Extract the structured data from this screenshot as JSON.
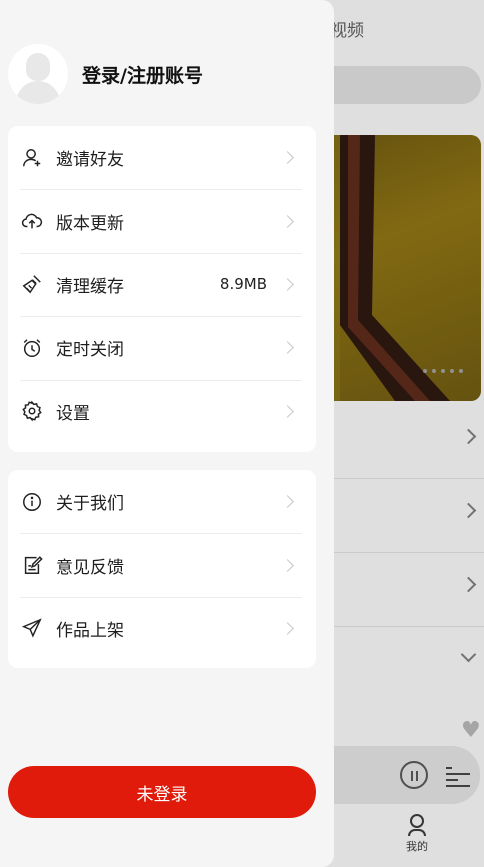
{
  "background": {
    "tab_label": "视频",
    "nav_mine_label": "我的"
  },
  "profile": {
    "title": "登录/注册账号"
  },
  "menu_group_1": [
    {
      "label": "邀请好友",
      "icon": "user-icon"
    },
    {
      "label": "版本更新",
      "icon": "cloud-upload-icon"
    },
    {
      "label": "清理缓存",
      "icon": "broom-icon",
      "value": "8.9MB"
    },
    {
      "label": "定时关闭",
      "icon": "alarm-clock-icon"
    },
    {
      "label": "设置",
      "icon": "gear-icon"
    }
  ],
  "menu_group_2": [
    {
      "label": "关于我们",
      "icon": "info-icon"
    },
    {
      "label": "意见反馈",
      "icon": "feedback-icon"
    },
    {
      "label": "作品上架",
      "icon": "send-icon"
    }
  ],
  "login_button": "未登录",
  "colors": {
    "accent": "#e01b0b",
    "drawer_bg": "#f5f5f5",
    "card_bg": "#ffffff"
  }
}
